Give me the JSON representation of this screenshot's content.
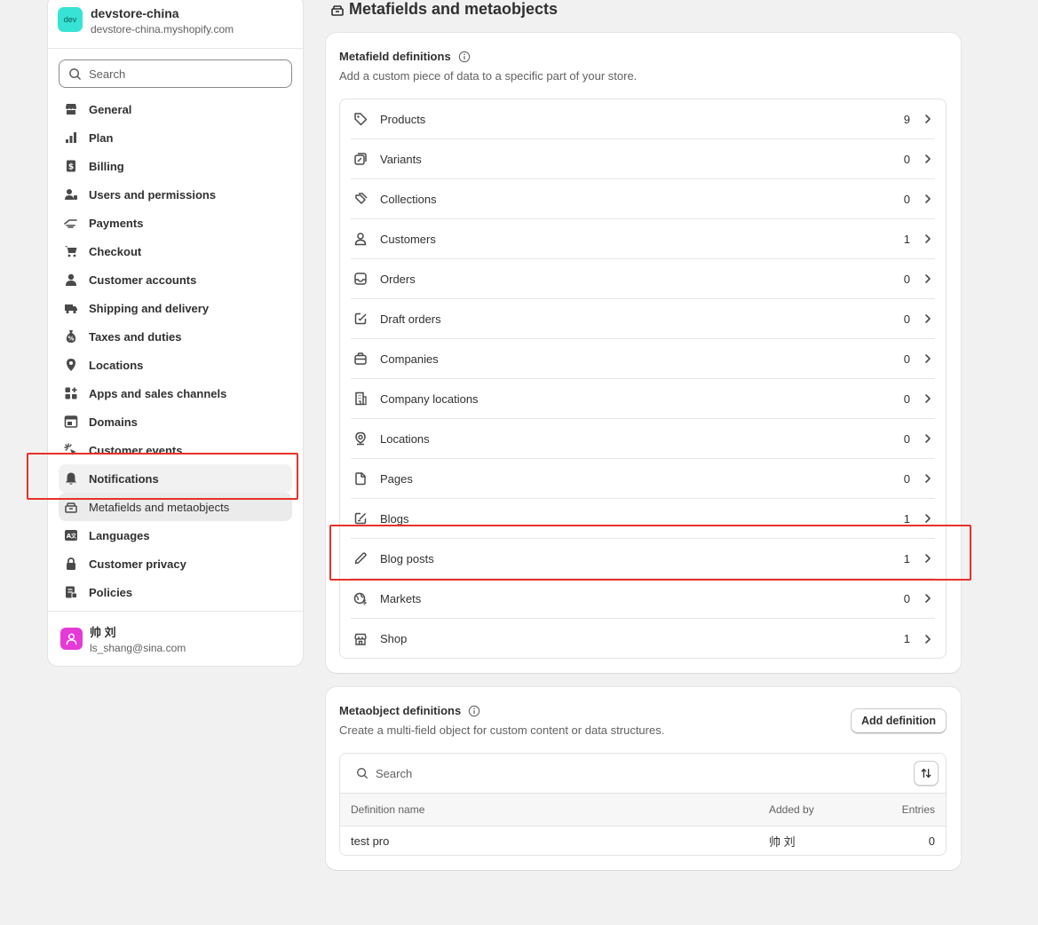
{
  "store": {
    "badge": "dev",
    "name": "devstore-china",
    "url": "devstore-china.myshopify.com"
  },
  "search": {
    "placeholder": "Search"
  },
  "nav": [
    {
      "label": "General",
      "icon": "store-icon"
    },
    {
      "label": "Plan",
      "icon": "plan-icon"
    },
    {
      "label": "Billing",
      "icon": "billing-icon"
    },
    {
      "label": "Users and permissions",
      "icon": "users-icon"
    },
    {
      "label": "Payments",
      "icon": "payments-icon"
    },
    {
      "label": "Checkout",
      "icon": "cart-icon"
    },
    {
      "label": "Customer accounts",
      "icon": "person-icon"
    },
    {
      "label": "Shipping and delivery",
      "icon": "truck-icon"
    },
    {
      "label": "Taxes and duties",
      "icon": "tax-icon"
    },
    {
      "label": "Locations",
      "icon": "location-icon"
    },
    {
      "label": "Apps and sales channels",
      "icon": "apps-icon"
    },
    {
      "label": "Domains",
      "icon": "domains-icon"
    },
    {
      "label": "Customer events",
      "icon": "cursor-icon"
    },
    {
      "label": "Notifications",
      "icon": "bell-icon"
    },
    {
      "label": "Metafields and metaobjects",
      "icon": "metafields-icon"
    },
    {
      "label": "Languages",
      "icon": "languages-icon"
    },
    {
      "label": "Customer privacy",
      "icon": "lock-icon"
    },
    {
      "label": "Policies",
      "icon": "policies-icon"
    }
  ],
  "user": {
    "name": "帅 刘",
    "email": "ls_shang@sina.com"
  },
  "page": {
    "title": "Metafields and metaobjects"
  },
  "metafields": {
    "title": "Metafield definitions",
    "subtitle": "Add a custom piece of data to a specific part of your store.",
    "rows": [
      {
        "label": "Products",
        "count": "9",
        "icon": "tag-icon"
      },
      {
        "label": "Variants",
        "count": "0",
        "icon": "variant-icon"
      },
      {
        "label": "Collections",
        "count": "0",
        "icon": "collection-icon"
      },
      {
        "label": "Customers",
        "count": "1",
        "icon": "person-icon"
      },
      {
        "label": "Orders",
        "count": "0",
        "icon": "inbox-icon"
      },
      {
        "label": "Draft orders",
        "count": "0",
        "icon": "draft-order-icon"
      },
      {
        "label": "Companies",
        "count": "0",
        "icon": "briefcase-icon"
      },
      {
        "label": "Company locations",
        "count": "0",
        "icon": "building-icon"
      },
      {
        "label": "Locations",
        "count": "0",
        "icon": "location-icon"
      },
      {
        "label": "Pages",
        "count": "0",
        "icon": "page-icon"
      },
      {
        "label": "Blogs",
        "count": "1",
        "icon": "blog-icon"
      },
      {
        "label": "Blog posts",
        "count": "1",
        "icon": "pencil-icon"
      },
      {
        "label": "Markets",
        "count": "0",
        "icon": "globe-icon"
      },
      {
        "label": "Shop",
        "count": "1",
        "icon": "shop-icon"
      }
    ]
  },
  "metaobjects": {
    "title": "Metaobject definitions",
    "subtitle": "Create a multi-field object for custom content or data structures.",
    "add_button": "Add definition",
    "search_placeholder": "Search",
    "columns": {
      "name": "Definition name",
      "added_by": "Added by",
      "entries": "Entries"
    },
    "rows": [
      {
        "name": "test pro",
        "added_by": "帅 刘",
        "entries": "0"
      }
    ]
  }
}
